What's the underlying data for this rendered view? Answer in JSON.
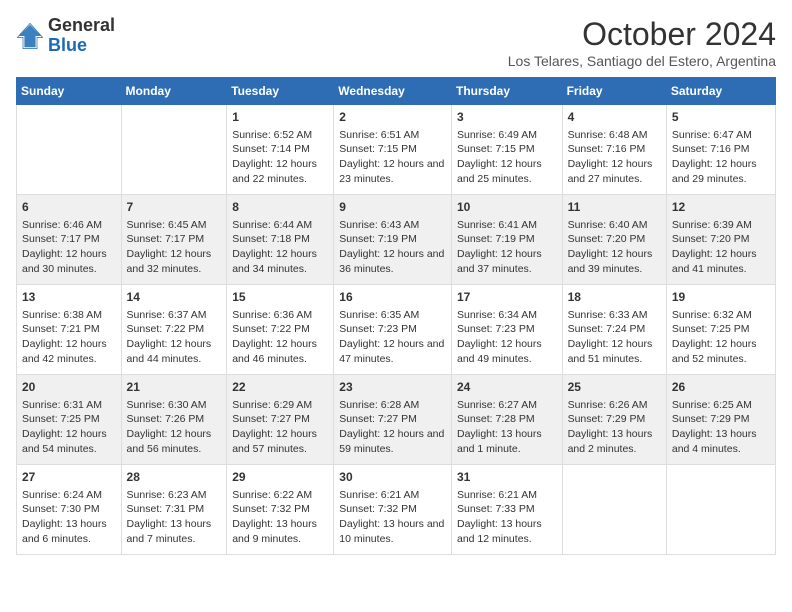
{
  "header": {
    "logo_general": "General",
    "logo_blue": "Blue",
    "month": "October 2024",
    "location": "Los Telares, Santiago del Estero, Argentina"
  },
  "days_of_week": [
    "Sunday",
    "Monday",
    "Tuesday",
    "Wednesday",
    "Thursday",
    "Friday",
    "Saturday"
  ],
  "weeks": [
    [
      {
        "day": "",
        "info": ""
      },
      {
        "day": "",
        "info": ""
      },
      {
        "day": "1",
        "sunrise": "6:52 AM",
        "sunset": "7:14 PM",
        "daylight": "12 hours and 22 minutes."
      },
      {
        "day": "2",
        "sunrise": "6:51 AM",
        "sunset": "7:15 PM",
        "daylight": "12 hours and 23 minutes."
      },
      {
        "day": "3",
        "sunrise": "6:49 AM",
        "sunset": "7:15 PM",
        "daylight": "12 hours and 25 minutes."
      },
      {
        "day": "4",
        "sunrise": "6:48 AM",
        "sunset": "7:16 PM",
        "daylight": "12 hours and 27 minutes."
      },
      {
        "day": "5",
        "sunrise": "6:47 AM",
        "sunset": "7:16 PM",
        "daylight": "12 hours and 29 minutes."
      }
    ],
    [
      {
        "day": "6",
        "sunrise": "6:46 AM",
        "sunset": "7:17 PM",
        "daylight": "12 hours and 30 minutes."
      },
      {
        "day": "7",
        "sunrise": "6:45 AM",
        "sunset": "7:17 PM",
        "daylight": "12 hours and 32 minutes."
      },
      {
        "day": "8",
        "sunrise": "6:44 AM",
        "sunset": "7:18 PM",
        "daylight": "12 hours and 34 minutes."
      },
      {
        "day": "9",
        "sunrise": "6:43 AM",
        "sunset": "7:19 PM",
        "daylight": "12 hours and 36 minutes."
      },
      {
        "day": "10",
        "sunrise": "6:41 AM",
        "sunset": "7:19 PM",
        "daylight": "12 hours and 37 minutes."
      },
      {
        "day": "11",
        "sunrise": "6:40 AM",
        "sunset": "7:20 PM",
        "daylight": "12 hours and 39 minutes."
      },
      {
        "day": "12",
        "sunrise": "6:39 AM",
        "sunset": "7:20 PM",
        "daylight": "12 hours and 41 minutes."
      }
    ],
    [
      {
        "day": "13",
        "sunrise": "6:38 AM",
        "sunset": "7:21 PM",
        "daylight": "12 hours and 42 minutes."
      },
      {
        "day": "14",
        "sunrise": "6:37 AM",
        "sunset": "7:22 PM",
        "daylight": "12 hours and 44 minutes."
      },
      {
        "day": "15",
        "sunrise": "6:36 AM",
        "sunset": "7:22 PM",
        "daylight": "12 hours and 46 minutes."
      },
      {
        "day": "16",
        "sunrise": "6:35 AM",
        "sunset": "7:23 PM",
        "daylight": "12 hours and 47 minutes."
      },
      {
        "day": "17",
        "sunrise": "6:34 AM",
        "sunset": "7:23 PM",
        "daylight": "12 hours and 49 minutes."
      },
      {
        "day": "18",
        "sunrise": "6:33 AM",
        "sunset": "7:24 PM",
        "daylight": "12 hours and 51 minutes."
      },
      {
        "day": "19",
        "sunrise": "6:32 AM",
        "sunset": "7:25 PM",
        "daylight": "12 hours and 52 minutes."
      }
    ],
    [
      {
        "day": "20",
        "sunrise": "6:31 AM",
        "sunset": "7:25 PM",
        "daylight": "12 hours and 54 minutes."
      },
      {
        "day": "21",
        "sunrise": "6:30 AM",
        "sunset": "7:26 PM",
        "daylight": "12 hours and 56 minutes."
      },
      {
        "day": "22",
        "sunrise": "6:29 AM",
        "sunset": "7:27 PM",
        "daylight": "12 hours and 57 minutes."
      },
      {
        "day": "23",
        "sunrise": "6:28 AM",
        "sunset": "7:27 PM",
        "daylight": "12 hours and 59 minutes."
      },
      {
        "day": "24",
        "sunrise": "6:27 AM",
        "sunset": "7:28 PM",
        "daylight": "13 hours and 1 minute."
      },
      {
        "day": "25",
        "sunrise": "6:26 AM",
        "sunset": "7:29 PM",
        "daylight": "13 hours and 2 minutes."
      },
      {
        "day": "26",
        "sunrise": "6:25 AM",
        "sunset": "7:29 PM",
        "daylight": "13 hours and 4 minutes."
      }
    ],
    [
      {
        "day": "27",
        "sunrise": "6:24 AM",
        "sunset": "7:30 PM",
        "daylight": "13 hours and 6 minutes."
      },
      {
        "day": "28",
        "sunrise": "6:23 AM",
        "sunset": "7:31 PM",
        "daylight": "13 hours and 7 minutes."
      },
      {
        "day": "29",
        "sunrise": "6:22 AM",
        "sunset": "7:32 PM",
        "daylight": "13 hours and 9 minutes."
      },
      {
        "day": "30",
        "sunrise": "6:21 AM",
        "sunset": "7:32 PM",
        "daylight": "13 hours and 10 minutes."
      },
      {
        "day": "31",
        "sunrise": "6:21 AM",
        "sunset": "7:33 PM",
        "daylight": "13 hours and 12 minutes."
      },
      {
        "day": "",
        "info": ""
      },
      {
        "day": "",
        "info": ""
      }
    ]
  ],
  "labels": {
    "sunrise": "Sunrise:",
    "sunset": "Sunset:",
    "daylight": "Daylight:"
  }
}
